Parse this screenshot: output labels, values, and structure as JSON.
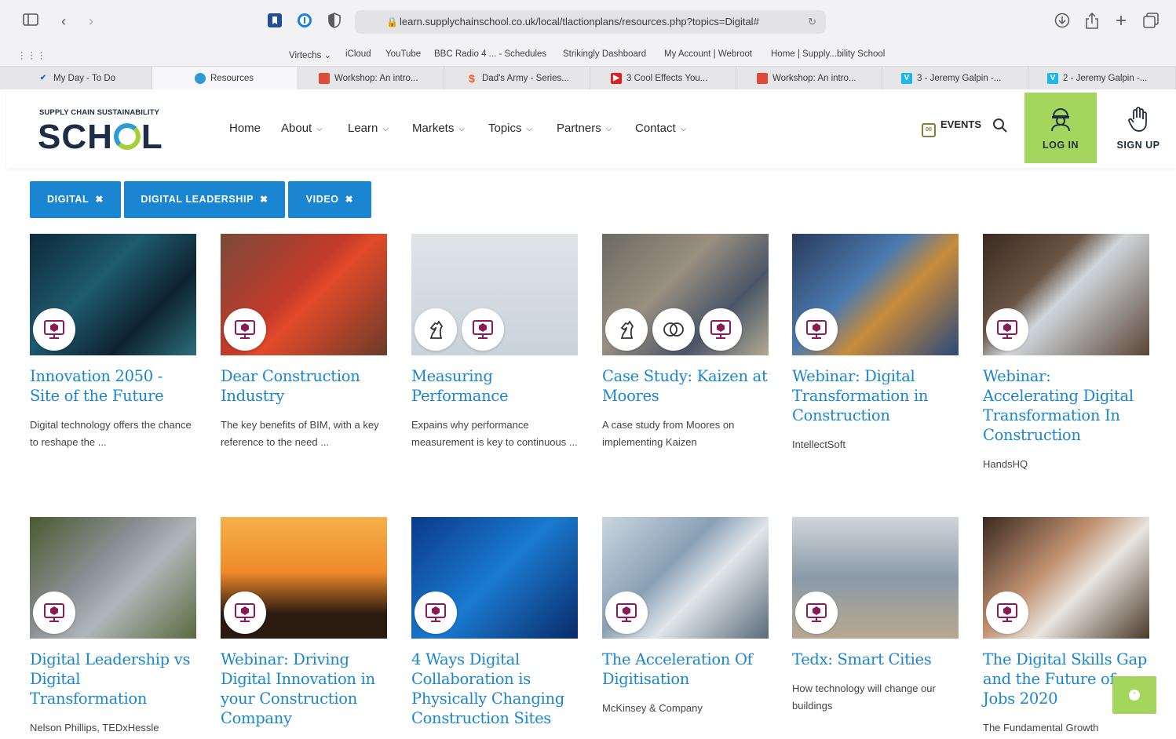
{
  "browser": {
    "url": "learn.supplychainschool.co.uk/local/tlactionplans/resources.php?topics=Digital#",
    "bookmarks": [
      "Virtechs ⌄",
      "iCloud",
      "YouTube",
      "BBC Radio 4 ... - Schedules",
      "Strikingly Dashboard",
      "My Account | Webroot",
      "Home | Supply...bility School"
    ],
    "tabs": [
      {
        "label": "My Day - To Do",
        "color": "#2564cf"
      },
      {
        "label": "Resources",
        "color": "#2e9bd6"
      },
      {
        "label": "Workshop: An intro...",
        "color": "#e04a3a"
      },
      {
        "label": "Dad's Army - Series...",
        "color": "#e85d2a"
      },
      {
        "label": "3 Cool Effects You...",
        "color": "#e02020"
      },
      {
        "label": "Workshop: An intro...",
        "color": "#e04a3a"
      },
      {
        "label": "3 - Jeremy Galpin -...",
        "color": "#1ab7ea"
      },
      {
        "label": "2 - Jeremy Galpin -...",
        "color": "#1ab7ea"
      }
    ]
  },
  "header": {
    "logo_small": "SUPPLY CHAIN SUSTAINABILITY",
    "logo_big_left": "SCH",
    "logo_big_right": "L",
    "nav": [
      "Home",
      "About",
      "Learn",
      "Markets",
      "Topics",
      "Partners",
      "Contact"
    ],
    "events_label": "EVENTS",
    "login_label": "LOG IN",
    "signup_label": "SIGN UP"
  },
  "filters": [
    "DIGITAL",
    "DIGITAL LEADERSHIP",
    "VIDEO"
  ],
  "cards": [
    {
      "title": "Innovation 2050 - Site of the Future",
      "desc": "Digital technology offers the chance to reshape the ..."
    },
    {
      "title": "Dear Construction Industry",
      "desc": "The key benefits of BIM, with a key reference to the need ..."
    },
    {
      "title": "Measuring Performance",
      "desc": "Expains why performance measurement is key to continuous ..."
    },
    {
      "title": "Case Study: Kaizen at Moores",
      "desc": "A case study from Moores on implementing Kaizen"
    },
    {
      "title": "Webinar: Digital Transformation in Construction",
      "desc": "IntellectSoft"
    },
    {
      "title": "Webinar: Accelerating Digital Transformation In Construction",
      "desc": "HandsHQ"
    },
    {
      "title": "Digital Leadership vs Digital Transformation",
      "desc": "Nelson Phillips, TEDxHessle"
    },
    {
      "title": "Webinar: Driving Digital Innovation in your Construction Company",
      "desc": ""
    },
    {
      "title": "4 Ways Digital Collaboration is Physically Changing Construction Sites",
      "desc": ""
    },
    {
      "title": "The Acceleration Of Digitisation",
      "desc": "McKinsey & Company"
    },
    {
      "title": "Tedx: Smart Cities",
      "desc": "How technology will change our buildings"
    },
    {
      "title": "The Digital Skills Gap and the Future of Jobs 2020",
      "desc": "The Fundamental Growth"
    }
  ],
  "icons": {
    "video": "computer-video-icon",
    "learning": "chess-knight-icon",
    "topic": "venn-icon"
  }
}
